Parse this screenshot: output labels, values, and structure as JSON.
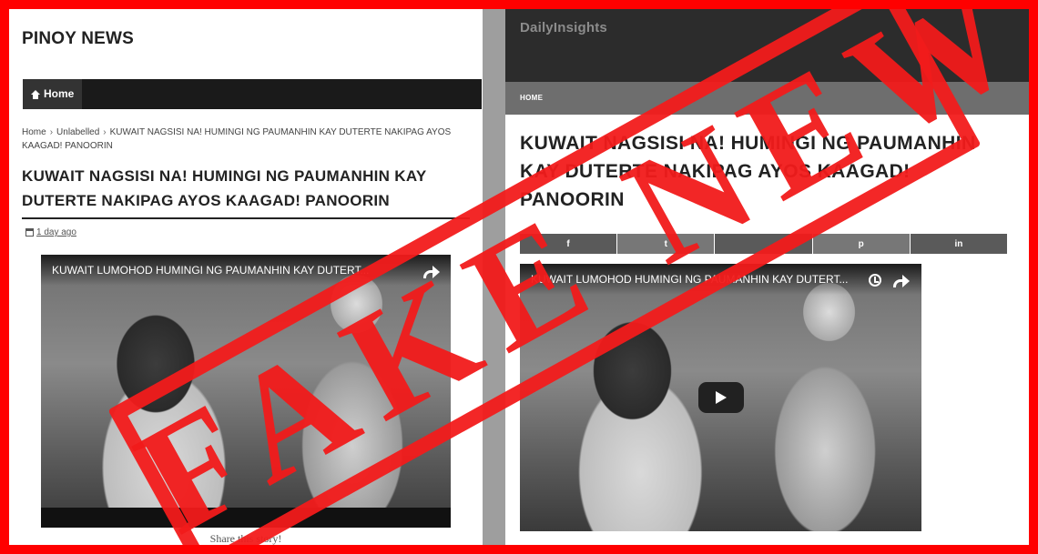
{
  "left_site": {
    "title": "PINOY NEWS",
    "nav_home": "Home",
    "breadcrumb": {
      "home": "Home",
      "category": "Unlabelled",
      "current": "KUWAIT NAGSISI NA! HUMINGI NG PAUMANHIN KAY DUTERTE NAKIPAG AYOS KAAGAD! PANOORIN"
    },
    "post_title": "KUWAIT NAGSISI NA! HUMINGI NG PAUMANHIN KAY DUTERTE NAKIPAG AYOS KAAGAD! PANOORIN",
    "post_date": "1 day ago",
    "video_title": "KUWAIT LUMOHOD HUMINGI NG PAUMANHIN KAY DUTERT...",
    "share_story": "Share this story!"
  },
  "right_site": {
    "title": "DailyInsights",
    "nav_home": "HOME",
    "post_title": "KUWAIT NAGSISI NA! HUMINGI NG PAUMANHIN KAY DUTERTE NAKIPAG AYOS KAAGAD! PANOORIN",
    "share_buttons": [
      {
        "icon": "facebook-icon",
        "glyph": "f"
      },
      {
        "icon": "twitter-icon",
        "glyph": "t"
      },
      {
        "icon": "google-plus-icon",
        "glyph": ""
      },
      {
        "icon": "pinterest-icon",
        "glyph": "p"
      },
      {
        "icon": "linkedin-icon",
        "glyph": "in"
      }
    ],
    "video_title": "KUWAIT LUMOHOD HUMINGI NG PAUMANHIN KAY DUTERT..."
  },
  "stamp": {
    "text": "FAKE NEWS",
    "color": "#f21b1b"
  },
  "colors": {
    "frame": "#ff0000",
    "left_nav": "#1a1a1a",
    "right_header": "#2c2c2c",
    "right_nav": "#6e6e6e"
  }
}
